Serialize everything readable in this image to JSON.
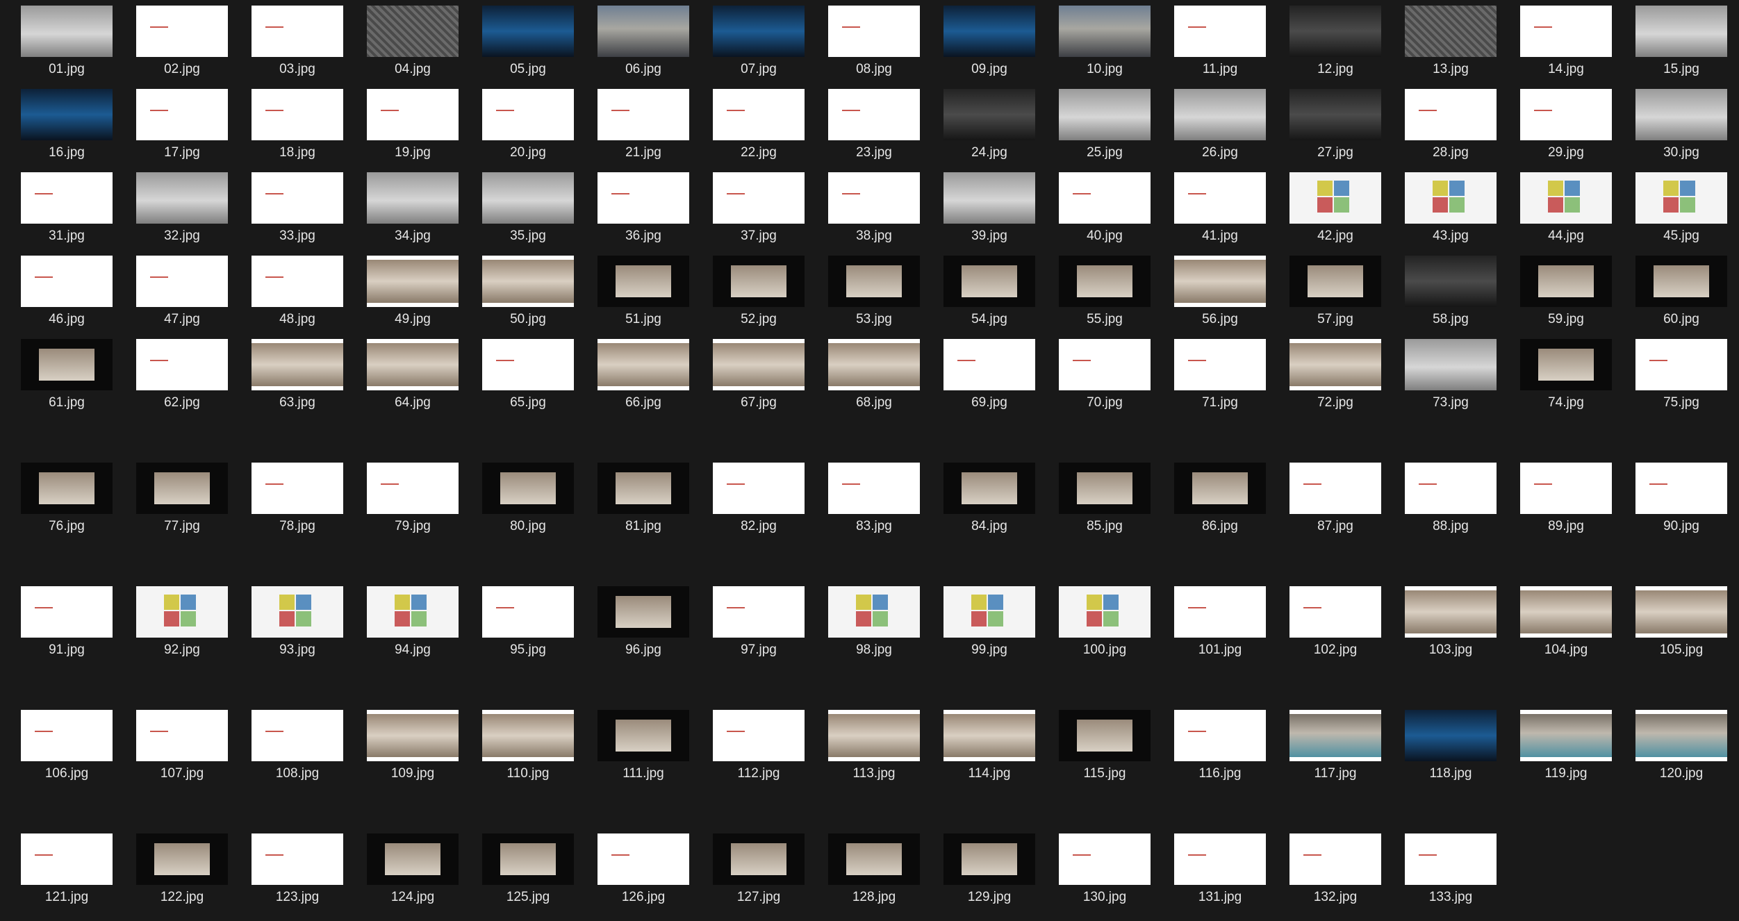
{
  "files": [
    {
      "name": "01.jpg",
      "style": "gray"
    },
    {
      "name": "02.jpg",
      "style": "white"
    },
    {
      "name": "03.jpg",
      "style": "white"
    },
    {
      "name": "04.jpg",
      "style": "map"
    },
    {
      "name": "05.jpg",
      "style": "blue"
    },
    {
      "name": "06.jpg",
      "style": "photo"
    },
    {
      "name": "07.jpg",
      "style": "blue"
    },
    {
      "name": "08.jpg",
      "style": "white"
    },
    {
      "name": "09.jpg",
      "style": "blue"
    },
    {
      "name": "10.jpg",
      "style": "photo"
    },
    {
      "name": "11.jpg",
      "style": "white"
    },
    {
      "name": "12.jpg",
      "style": "dark"
    },
    {
      "name": "13.jpg",
      "style": "map"
    },
    {
      "name": "14.jpg",
      "style": "white"
    },
    {
      "name": "15.jpg",
      "style": "gray"
    },
    {
      "name": "16.jpg",
      "style": "blue"
    },
    {
      "name": "17.jpg",
      "style": "white"
    },
    {
      "name": "18.jpg",
      "style": "white"
    },
    {
      "name": "19.jpg",
      "style": "white"
    },
    {
      "name": "20.jpg",
      "style": "white"
    },
    {
      "name": "21.jpg",
      "style": "white"
    },
    {
      "name": "22.jpg",
      "style": "white"
    },
    {
      "name": "23.jpg",
      "style": "white"
    },
    {
      "name": "24.jpg",
      "style": "dark"
    },
    {
      "name": "25.jpg",
      "style": "gray"
    },
    {
      "name": "26.jpg",
      "style": "gray"
    },
    {
      "name": "27.jpg",
      "style": "dark"
    },
    {
      "name": "28.jpg",
      "style": "white"
    },
    {
      "name": "29.jpg",
      "style": "white"
    },
    {
      "name": "30.jpg",
      "style": "gray"
    },
    {
      "name": "31.jpg",
      "style": "white"
    },
    {
      "name": "32.jpg",
      "style": "gray"
    },
    {
      "name": "33.jpg",
      "style": "white"
    },
    {
      "name": "34.jpg",
      "style": "gray"
    },
    {
      "name": "35.jpg",
      "style": "gray"
    },
    {
      "name": "36.jpg",
      "style": "white"
    },
    {
      "name": "37.jpg",
      "style": "white"
    },
    {
      "name": "38.jpg",
      "style": "white"
    },
    {
      "name": "39.jpg",
      "style": "gray"
    },
    {
      "name": "40.jpg",
      "style": "white"
    },
    {
      "name": "41.jpg",
      "style": "white"
    },
    {
      "name": "42.jpg",
      "style": "colorboard"
    },
    {
      "name": "43.jpg",
      "style": "colorboard"
    },
    {
      "name": "44.jpg",
      "style": "colorboard"
    },
    {
      "name": "45.jpg",
      "style": "colorboard"
    },
    {
      "name": "46.jpg",
      "style": "white"
    },
    {
      "name": "47.jpg",
      "style": "white"
    },
    {
      "name": "48.jpg",
      "style": "white"
    },
    {
      "name": "49.jpg",
      "style": "warm"
    },
    {
      "name": "50.jpg",
      "style": "warm"
    },
    {
      "name": "51.jpg",
      "style": "black"
    },
    {
      "name": "52.jpg",
      "style": "black"
    },
    {
      "name": "53.jpg",
      "style": "black"
    },
    {
      "name": "54.jpg",
      "style": "black"
    },
    {
      "name": "55.jpg",
      "style": "black"
    },
    {
      "name": "56.jpg",
      "style": "warm"
    },
    {
      "name": "57.jpg",
      "style": "black"
    },
    {
      "name": "58.jpg",
      "style": "dark"
    },
    {
      "name": "59.jpg",
      "style": "black"
    },
    {
      "name": "60.jpg",
      "style": "black"
    },
    {
      "name": "61.jpg",
      "style": "black"
    },
    {
      "name": "62.jpg",
      "style": "white"
    },
    {
      "name": "63.jpg",
      "style": "warm"
    },
    {
      "name": "64.jpg",
      "style": "warm"
    },
    {
      "name": "65.jpg",
      "style": "white"
    },
    {
      "name": "66.jpg",
      "style": "warm"
    },
    {
      "name": "67.jpg",
      "style": "warm"
    },
    {
      "name": "68.jpg",
      "style": "warm"
    },
    {
      "name": "69.jpg",
      "style": "white"
    },
    {
      "name": "70.jpg",
      "style": "white"
    },
    {
      "name": "71.jpg",
      "style": "white"
    },
    {
      "name": "72.jpg",
      "style": "warm"
    },
    {
      "name": "73.jpg",
      "style": "gray"
    },
    {
      "name": "74.jpg",
      "style": "black"
    },
    {
      "name": "75.jpg",
      "style": "white"
    },
    {
      "name": "76.jpg",
      "style": "black"
    },
    {
      "name": "77.jpg",
      "style": "black"
    },
    {
      "name": "78.jpg",
      "style": "white"
    },
    {
      "name": "79.jpg",
      "style": "white"
    },
    {
      "name": "80.jpg",
      "style": "black"
    },
    {
      "name": "81.jpg",
      "style": "black"
    },
    {
      "name": "82.jpg",
      "style": "white"
    },
    {
      "name": "83.jpg",
      "style": "white"
    },
    {
      "name": "84.jpg",
      "style": "black"
    },
    {
      "name": "85.jpg",
      "style": "black"
    },
    {
      "name": "86.jpg",
      "style": "black"
    },
    {
      "name": "87.jpg",
      "style": "white"
    },
    {
      "name": "88.jpg",
      "style": "white"
    },
    {
      "name": "89.jpg",
      "style": "white"
    },
    {
      "name": "90.jpg",
      "style": "white"
    },
    {
      "name": "91.jpg",
      "style": "white"
    },
    {
      "name": "92.jpg",
      "style": "colorboard"
    },
    {
      "name": "93.jpg",
      "style": "colorboard"
    },
    {
      "name": "94.jpg",
      "style": "colorboard"
    },
    {
      "name": "95.jpg",
      "style": "white"
    },
    {
      "name": "96.jpg",
      "style": "black"
    },
    {
      "name": "97.jpg",
      "style": "white"
    },
    {
      "name": "98.jpg",
      "style": "colorboard"
    },
    {
      "name": "99.jpg",
      "style": "colorboard"
    },
    {
      "name": "100.jpg",
      "style": "colorboard"
    },
    {
      "name": "101.jpg",
      "style": "white"
    },
    {
      "name": "102.jpg",
      "style": "white"
    },
    {
      "name": "103.jpg",
      "style": "warm"
    },
    {
      "name": "104.jpg",
      "style": "warm"
    },
    {
      "name": "105.jpg",
      "style": "warm"
    },
    {
      "name": "106.jpg",
      "style": "white"
    },
    {
      "name": "107.jpg",
      "style": "white"
    },
    {
      "name": "108.jpg",
      "style": "white"
    },
    {
      "name": "109.jpg",
      "style": "warm"
    },
    {
      "name": "110.jpg",
      "style": "warm"
    },
    {
      "name": "111.jpg",
      "style": "black"
    },
    {
      "name": "112.jpg",
      "style": "white"
    },
    {
      "name": "113.jpg",
      "style": "warm"
    },
    {
      "name": "114.jpg",
      "style": "warm"
    },
    {
      "name": "115.jpg",
      "style": "black"
    },
    {
      "name": "116.jpg",
      "style": "white"
    },
    {
      "name": "117.jpg",
      "style": "pool"
    },
    {
      "name": "118.jpg",
      "style": "blue"
    },
    {
      "name": "119.jpg",
      "style": "pool"
    },
    {
      "name": "120.jpg",
      "style": "pool"
    },
    {
      "name": "121.jpg",
      "style": "white"
    },
    {
      "name": "122.jpg",
      "style": "black"
    },
    {
      "name": "123.jpg",
      "style": "white"
    },
    {
      "name": "124.jpg",
      "style": "black"
    },
    {
      "name": "125.jpg",
      "style": "black"
    },
    {
      "name": "126.jpg",
      "style": "white"
    },
    {
      "name": "127.jpg",
      "style": "black"
    },
    {
      "name": "128.jpg",
      "style": "black"
    },
    {
      "name": "129.jpg",
      "style": "black"
    },
    {
      "name": "130.jpg",
      "style": "white"
    },
    {
      "name": "131.jpg",
      "style": "white"
    },
    {
      "name": "132.jpg",
      "style": "white"
    },
    {
      "name": "133.jpg",
      "style": "white"
    }
  ]
}
